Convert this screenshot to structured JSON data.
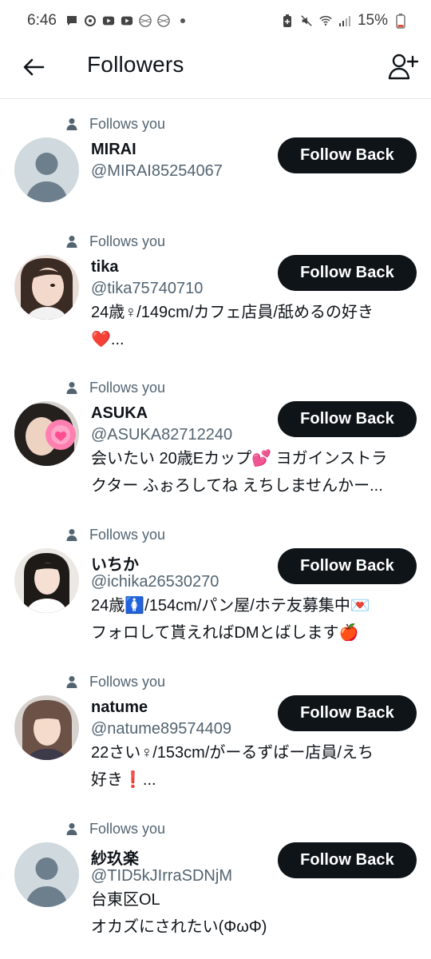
{
  "status_bar": {
    "time": "6:46",
    "battery": "15%"
  },
  "header": {
    "title": "Followers"
  },
  "followers": [
    {
      "follows_label": "Follows you",
      "name": "MIRAI",
      "handle": "@MIRAI85254067",
      "bio_line1": "",
      "bio_line2": "",
      "button": "Follow Back",
      "avatar": "default"
    },
    {
      "follows_label": "Follows you",
      "name": "tika",
      "handle": "@tika75740710",
      "bio_line1": "24歳♀/149cm/カフェ店員/舐めるの好き",
      "bio_line2": "❤️...",
      "button": "Follow Back",
      "avatar": "photo"
    },
    {
      "follows_label": "Follows you",
      "name": "ASUKA",
      "handle": "@ASUKA82712240",
      "bio_line1": "会いたい 20歳Eカップ💕 ヨガインストラ",
      "bio_line2": "クター ふぉろしてね えちしませんかー...",
      "button": "Follow Back",
      "avatar": "photo"
    },
    {
      "follows_label": "Follows you",
      "name": "いちか",
      "handle": "@ichika26530270",
      "bio_line1": "24歳🚺/154cm/パン屋/ホテ友募集中💌",
      "bio_line2": "フォロして貰えればDMとばします🍎",
      "button": "Follow Back",
      "avatar": "photo"
    },
    {
      "follows_label": "Follows you",
      "name": "natume",
      "handle": "@natume89574409",
      "bio_line1": "22さい♀/153cm/がーるずばー店員/えち",
      "bio_line2": "好き❗...",
      "button": "Follow Back",
      "avatar": "photo"
    },
    {
      "follows_label": "Follows you",
      "name": "紗玖楽",
      "handle": "@TID5kJIrraSDNjM",
      "bio_line1": "台東区OL",
      "bio_line2": "オカズにされたい(ΦωΦ)",
      "button": "Follow Back",
      "avatar": "default"
    }
  ]
}
